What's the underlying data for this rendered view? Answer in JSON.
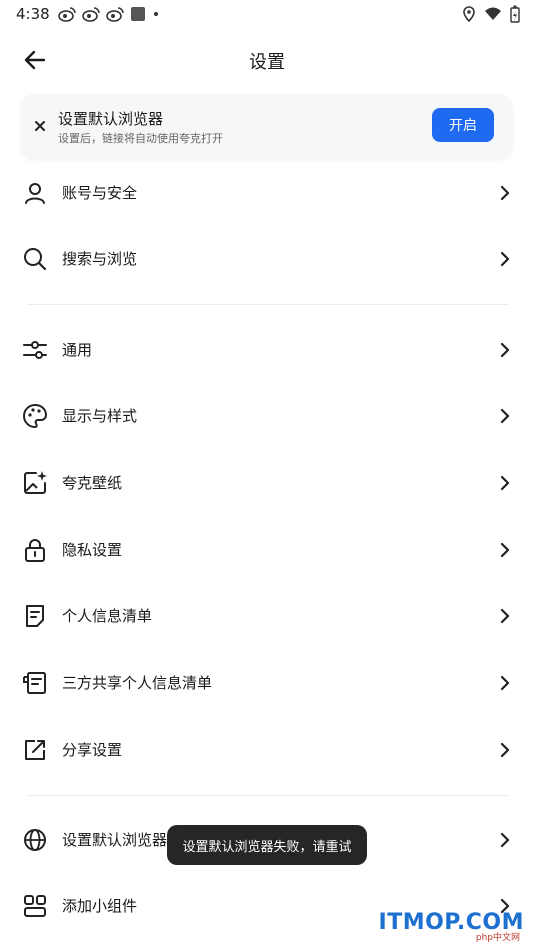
{
  "status": {
    "time": "4:38"
  },
  "header": {
    "title": "设置"
  },
  "banner": {
    "title": "设置默认浏览器",
    "subtitle": "设置后，链接将自动使用夸克打开",
    "button_label": "开启"
  },
  "menu": {
    "account": "账号与安全",
    "search": "搜索与浏览",
    "general": "通用",
    "display": "显示与样式",
    "wallpaper": "夸克壁纸",
    "privacy": "隐私设置",
    "personal_info": "个人信息清单",
    "third_party": "三方共享个人信息清单",
    "share": "分享设置",
    "default_browser": "设置默认浏览器",
    "widget": "添加小组件"
  },
  "toast": {
    "message": "设置默认浏览器失败，请重试"
  },
  "watermark": {
    "text": "ITMOP.COM",
    "sub": "php中文网"
  },
  "colors": {
    "accent": "#1e6bf2",
    "toast_bg": "#262626"
  }
}
